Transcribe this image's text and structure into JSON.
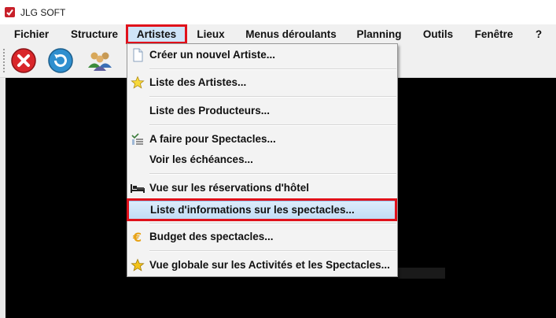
{
  "window": {
    "title": "JLG SOFT"
  },
  "menubar": {
    "items": [
      {
        "label": "Fichier"
      },
      {
        "label": "Structure"
      },
      {
        "label": "Artistes"
      },
      {
        "label": "Lieux"
      },
      {
        "label": "Menus déroulants"
      },
      {
        "label": "Planning"
      },
      {
        "label": "Outils"
      },
      {
        "label": "Fenêtre"
      },
      {
        "label": "?"
      }
    ]
  },
  "toolbar": {
    "buttons": [
      {
        "icon": "close-red-icon"
      },
      {
        "icon": "refresh-icon"
      },
      {
        "icon": "users-icon"
      }
    ]
  },
  "dropdown": {
    "items": [
      {
        "label": "Créer un nouvel Artiste...",
        "icon": "new-document-icon"
      },
      {
        "label": "Liste des Artistes...",
        "icon": "star-icon"
      },
      {
        "label": "Liste des Producteurs...",
        "icon": ""
      },
      {
        "label": "A faire pour Spectacles...",
        "icon": "checklist-icon"
      },
      {
        "label": "Voir les échéances...",
        "icon": ""
      },
      {
        "label": "Vue sur les réservations d'hôtel",
        "icon": "bed-icon"
      },
      {
        "label": "Liste d'informations sur les spectacles...",
        "icon": "",
        "highlighted": true
      },
      {
        "label": "Budget des spectacles...",
        "icon": "euro-icon"
      },
      {
        "label": "Vue globale sur les Activités et les Spectacles...",
        "icon": "star-icon"
      }
    ]
  },
  "colors": {
    "highlight_box": "#e0111b",
    "menu_active": "#cfe4f7"
  }
}
